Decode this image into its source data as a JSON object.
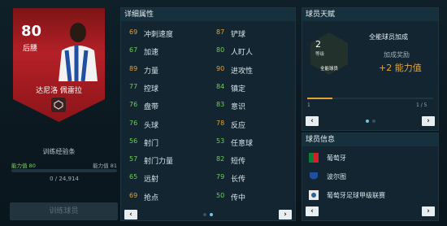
{
  "card": {
    "rating": "80",
    "position": "后腰",
    "name": "达尼洛 佩雷拉"
  },
  "training": {
    "title": "训练经验条",
    "left_label": "能力值 80",
    "right_label": "能力值 81",
    "count": "0 / 24,914",
    "button": "训练球员",
    "progress": 0
  },
  "stats_panel": {
    "title": "详细属性",
    "left": [
      {
        "value": "69",
        "name": "冲刺速度",
        "color": "o"
      },
      {
        "value": "67",
        "name": "加速",
        "color": "g"
      },
      {
        "value": "89",
        "name": "力量",
        "color": "o"
      },
      {
        "value": "77",
        "name": "控球",
        "color": "g"
      },
      {
        "value": "76",
        "name": "盘带",
        "color": "g"
      },
      {
        "value": "76",
        "name": "头球",
        "color": "g"
      },
      {
        "value": "56",
        "name": "射门",
        "color": "g"
      },
      {
        "value": "57",
        "name": "射门力量",
        "color": "g"
      },
      {
        "value": "65",
        "name": "远射",
        "color": "g"
      },
      {
        "value": "69",
        "name": "抢点",
        "color": "o"
      }
    ],
    "right": [
      {
        "value": "87",
        "name": "铲球",
        "color": "o"
      },
      {
        "value": "80",
        "name": "人盯人",
        "color": "g"
      },
      {
        "value": "90",
        "name": "进攻性",
        "color": "o"
      },
      {
        "value": "84",
        "name": "镇定",
        "color": "g"
      },
      {
        "value": "83",
        "name": "意识",
        "color": "g"
      },
      {
        "value": "78",
        "name": "反应",
        "color": "o"
      },
      {
        "value": "53",
        "name": "任意球",
        "color": "g"
      },
      {
        "value": "82",
        "name": "短传",
        "color": "g"
      },
      {
        "value": "79",
        "name": "长传",
        "color": "g"
      },
      {
        "value": "50",
        "name": "传中",
        "color": "g"
      }
    ]
  },
  "talent": {
    "title": "球员天赋",
    "level": "2",
    "level_label": "等级",
    "skill_title": "全能球员",
    "skill_name": "全能球员加成",
    "bonus_label": "加成奖励",
    "bonus_value": "+2 能力值",
    "slider_left": "1",
    "slider_right": "1 / 5",
    "progress": 0.2
  },
  "player_info": {
    "title": "球员信息",
    "items": [
      {
        "text": "葡萄牙",
        "icon": "portugal-flag-icon"
      },
      {
        "text": "波尔图",
        "icon": "porto-crest-icon"
      },
      {
        "text": "葡萄牙足球甲级联赛",
        "icon": "league-logo-icon"
      }
    ]
  },
  "nav": {
    "prev": "‹",
    "next": "›"
  }
}
